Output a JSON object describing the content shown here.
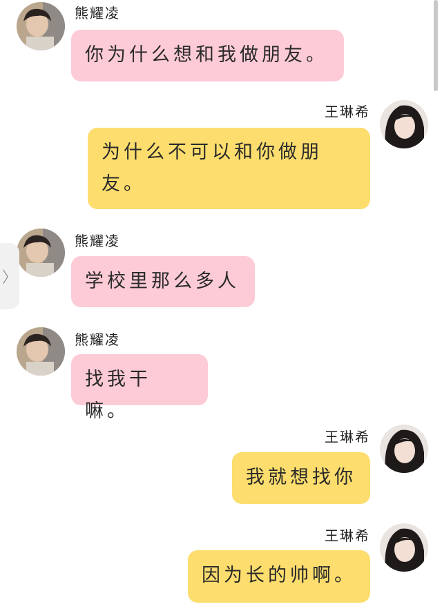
{
  "colors": {
    "incoming_bubble": "#fdcbd6",
    "outgoing_bubble": "#fcdd6d"
  },
  "side_handle": {
    "icon": "chevron-right-icon",
    "glyph": "〉"
  },
  "messages": [
    {
      "sender": "熊耀凌",
      "side": "left",
      "text": "你为什么想和我做朋友。",
      "avatar": "boy-avatar"
    },
    {
      "sender": "王琳希",
      "side": "right",
      "text": "为什么不可以和你做朋友。",
      "avatar": "girl-avatar"
    },
    {
      "sender": "熊耀凌",
      "side": "left",
      "text": "学校里那么多人",
      "avatar": "boy-avatar"
    },
    {
      "sender": "熊耀凌",
      "side": "left",
      "text": "找我干嘛。",
      "avatar": "boy-avatar"
    },
    {
      "sender": "王琳希",
      "side": "right",
      "text": "我就想找你",
      "avatar": "girl-avatar"
    },
    {
      "sender": "王琳希",
      "side": "right",
      "text": "因为长的帅啊。",
      "avatar": "girl-avatar"
    }
  ]
}
